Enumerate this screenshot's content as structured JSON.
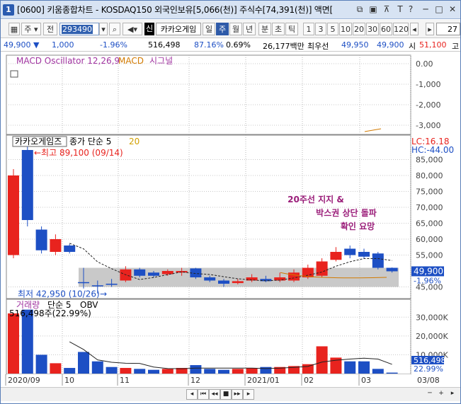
{
  "titlebar": {
    "screen_no": "[0600]",
    "title": "[0600] 키움종합차트 - KOSDAQ150 외국인보유[5,066(천)] 주식수[74,391(천)] 액면[",
    "app_icon": "1"
  },
  "toolbar": {
    "grid_icon_label": "",
    "period_select": "주",
    "prev_label": "전",
    "stock_code": "293490",
    "sin_label": "신",
    "stock_name": "카카오게임",
    "periods": [
      "일",
      "주",
      "월",
      "년",
      "분",
      "초",
      "틱"
    ],
    "selected_period": "주",
    "minutes": [
      "1",
      "3",
      "5",
      "10",
      "20",
      "30",
      "60",
      "120"
    ],
    "count_value": "27"
  },
  "infobar": {
    "price": "49,900",
    "price_arrow": "▼",
    "change": "1,000",
    "change_pct": "-1.96%",
    "volume": "516,498",
    "vol_ratio": "87.16%",
    "turnover": "0.69%",
    "trade_value": "26,177백만",
    "best_ask_label": "최우선",
    "best_ask": "49,950",
    "best_bid": "49,900",
    "open_label": "시",
    "open_value": "51,100",
    "high_label": "고"
  },
  "macd_panel": {
    "label_osc": "MACD Oscillator 12,26,9",
    "label_macd": "MACD",
    "label_signal": "시그널",
    "ticks": [
      "0.00",
      "-1,000",
      "-2,000",
      "-3,000"
    ]
  },
  "price_panel": {
    "stock_label": "카카오게임즈",
    "ma_label": "종가 단순 5",
    "ma_value": "20",
    "lc_label": "LC:16.18",
    "hc_label": "HC:-44.00",
    "high_annot": "←최고 89,100 (09/14)",
    "low_annot": "최저 42,950 (10/26)",
    "low_arrow": "→",
    "current_price": "49,900",
    "current_pct": "-1.96%",
    "annotation_line1": "20주선 지지 &",
    "annotation_line2": "박스권 상단 돌파",
    "annotation_line3": "확인 요망",
    "ticks": [
      "85,000",
      "80,000",
      "75,000",
      "70,000",
      "65,000",
      "60,000",
      "55,000",
      "45,000"
    ],
    "box_top": 51000,
    "box_bottom": 45000
  },
  "volume_panel": {
    "label": "거래량",
    "ma_label": "단순 5",
    "obv_label": "OBV",
    "value_label": "516,498주(22.99%)",
    "ticks": [
      "30,000K",
      "20,000K",
      "10,000K"
    ],
    "current_value": "516,498",
    "current_pct": "22.99%"
  },
  "x_axis": {
    "labels": [
      "2020/09",
      "10",
      "11",
      "12",
      "2021/01",
      "02",
      "03",
      "03/08"
    ]
  },
  "chart_data": {
    "type": "candlestick",
    "y_range": [
      42000,
      92000
    ],
    "candles": [
      {
        "o": 80000,
        "c": 55000,
        "h": 82000,
        "l": 54000,
        "up": true,
        "v": 32000
      },
      {
        "o": 88000,
        "c": 66000,
        "h": 89100,
        "l": 64000,
        "up": false,
        "v": 34000
      },
      {
        "o": 63000,
        "c": 56500,
        "h": 64000,
        "l": 55500,
        "up": false,
        "v": 10000
      },
      {
        "o": 56000,
        "c": 60000,
        "h": 61500,
        "l": 55000,
        "up": true,
        "v": 5500
      },
      {
        "o": 58000,
        "c": 56000,
        "h": 58500,
        "l": 55500,
        "up": false,
        "v": 3000
      },
      {
        "o": 46500,
        "c": 46300,
        "h": 51000,
        "l": 44500,
        "up": false,
        "v": 11500
      },
      {
        "o": 45500,
        "c": 45500,
        "h": 47000,
        "l": 42950,
        "up": false,
        "v": 6500
      },
      {
        "o": 46000,
        "c": 45800,
        "h": 47500,
        "l": 45000,
        "up": false,
        "v": 3500
      },
      {
        "o": 47000,
        "c": 50500,
        "h": 51500,
        "l": 46500,
        "up": true,
        "v": 3000
      },
      {
        "o": 50500,
        "c": 48500,
        "h": 51000,
        "l": 48000,
        "up": false,
        "v": 2500
      },
      {
        "o": 48500,
        "c": 49500,
        "h": 50000,
        "l": 48000,
        "up": false,
        "v": 2000
      },
      {
        "o": 49000,
        "c": 50000,
        "h": 50500,
        "l": 48500,
        "up": true,
        "v": 2500
      },
      {
        "o": 49500,
        "c": 50000,
        "h": 51000,
        "l": 48500,
        "up": true,
        "v": 3000
      },
      {
        "o": 50800,
        "c": 48000,
        "h": 51000,
        "l": 47500,
        "up": false,
        "v": 4500
      },
      {
        "o": 48000,
        "c": 47000,
        "h": 48500,
        "l": 46500,
        "up": false,
        "v": 2500
      },
      {
        "o": 47000,
        "c": 46000,
        "h": 47500,
        "l": 45000,
        "up": false,
        "v": 2000
      },
      {
        "o": 46200,
        "c": 46800,
        "h": 47500,
        "l": 45800,
        "up": true,
        "v": 2500
      },
      {
        "o": 47000,
        "c": 48000,
        "h": 49000,
        "l": 46500,
        "up": true,
        "v": 3000
      },
      {
        "o": 47500,
        "c": 46800,
        "h": 48500,
        "l": 46500,
        "up": false,
        "v": 3500
      },
      {
        "o": 47000,
        "c": 48000,
        "h": 49500,
        "l": 46500,
        "up": true,
        "v": 3500
      },
      {
        "o": 47000,
        "c": 49500,
        "h": 50500,
        "l": 46500,
        "up": true,
        "v": 4000
      },
      {
        "o": 48000,
        "c": 51000,
        "h": 52000,
        "l": 47500,
        "up": true,
        "v": 5000
      },
      {
        "o": 48500,
        "c": 53000,
        "h": 54000,
        "l": 48000,
        "up": true,
        "v": 14500
      },
      {
        "o": 53500,
        "c": 56000,
        "h": 57500,
        "l": 53000,
        "up": true,
        "v": 8500
      },
      {
        "o": 57000,
        "c": 55000,
        "h": 58000,
        "l": 54000,
        "up": false,
        "v": 6500
      },
      {
        "o": 56000,
        "c": 54500,
        "h": 57000,
        "l": 54000,
        "up": false,
        "v": 6500
      },
      {
        "o": 55500,
        "c": 51000,
        "h": 56000,
        "l": 50500,
        "up": false,
        "v": 2500
      },
      {
        "o": 51000,
        "c": 49900,
        "h": 51100,
        "l": 49500,
        "up": false,
        "v": 516
      }
    ]
  },
  "colors": {
    "up": "#e8231e",
    "down": "#1d4fc4",
    "accent": "#9b1e7a"
  }
}
